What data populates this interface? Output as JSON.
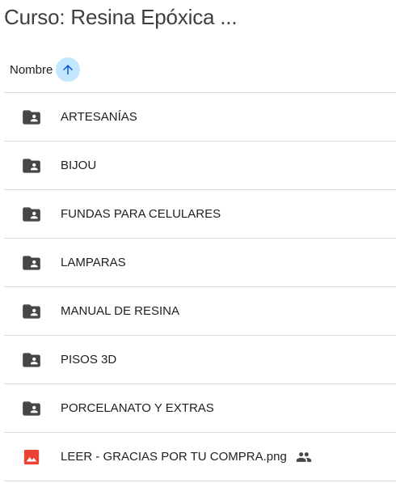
{
  "header": {
    "title": "Curso: Resina Epóxica ..."
  },
  "sort": {
    "label": "Nombre",
    "direction_icon": "arrow-up-icon",
    "accent_color": "#c2e7ff",
    "icon_color": "#0b57d0"
  },
  "items": [
    {
      "label": "ARTESANÍAS",
      "type": "shared-folder",
      "icon": "shared-folder-icon"
    },
    {
      "label": "BIJOU",
      "type": "shared-folder",
      "icon": "shared-folder-icon"
    },
    {
      "label": "FUNDAS PARA CELULARES",
      "type": "shared-folder",
      "icon": "shared-folder-icon"
    },
    {
      "label": "LAMPARAS",
      "type": "shared-folder",
      "icon": "shared-folder-icon"
    },
    {
      "label": "MANUAL DE RESINA",
      "type": "shared-folder",
      "icon": "shared-folder-icon"
    },
    {
      "label": "PISOS 3D",
      "type": "shared-folder",
      "icon": "shared-folder-icon"
    },
    {
      "label": "PORCELANATO Y EXTRAS",
      "type": "shared-folder",
      "icon": "shared-folder-icon"
    },
    {
      "label": "LEER - GRACIAS POR TU COMPRA.png",
      "type": "image",
      "icon": "image-file-icon",
      "shared": true,
      "shared_icon": "people-icon"
    }
  ],
  "colors": {
    "folder": "#444746",
    "image_file": "#ea4335",
    "divider": "#dadce0"
  }
}
